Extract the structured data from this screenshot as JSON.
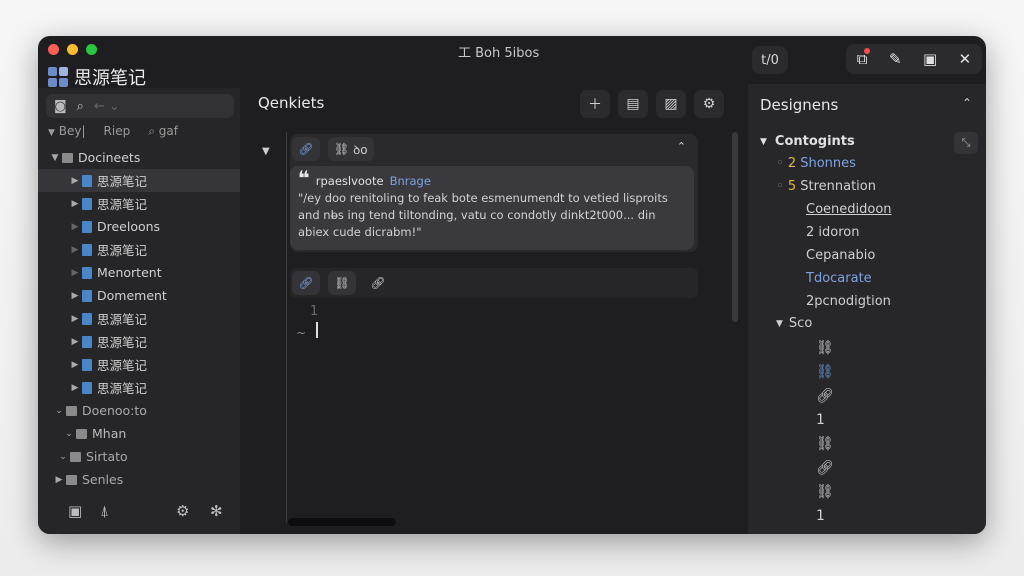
{
  "window": {
    "title": "工 Boh 5ibos"
  },
  "app": {
    "name": "思源笔记"
  },
  "toolbar_right": {
    "badge_label": "t/0"
  },
  "sidebar": {
    "filter": {
      "left": "Bey|",
      "mid": "Riep",
      "right": "gaf"
    },
    "root": "Docineets",
    "items": [
      {
        "label": "思源笔记",
        "selected": true
      },
      {
        "label": "思源笔记"
      },
      {
        "label": "Dreeloons"
      },
      {
        "label": "思源笔记"
      },
      {
        "label": "Menortent"
      },
      {
        "label": "Domement"
      },
      {
        "label": "思源笔记"
      },
      {
        "label": "思源笔记"
      },
      {
        "label": "思源笔记"
      },
      {
        "label": "思源笔记"
      }
    ],
    "folders": [
      {
        "label": "Doenoo:to"
      },
      {
        "label": "Mhan"
      },
      {
        "label": "Sirtato"
      },
      {
        "label": "Senles"
      }
    ]
  },
  "editor": {
    "title": "Qenkiets",
    "card": {
      "chip2": "ꝺo",
      "quote_author": "rpaeslvoote",
      "quote_tag": "Bnrage",
      "quote_text": "\"/ey doo renitoling to feak bote esmenumendt to vetied lisproits and nb̶s ing tend tiltonding, vatu co condotly dinkt2t000... din abiex cude dicrabm!\""
    },
    "line_number": "1",
    "line_marker": "~"
  },
  "right_panel": {
    "title": "Designens",
    "section": "Contogints",
    "outline": [
      {
        "num": "2",
        "label": "Shonnes",
        "style": "blue"
      },
      {
        "num": "5",
        "label": "Strennation",
        "style": "plain"
      },
      {
        "num": "",
        "label": "Coenedidoon",
        "style": "underline"
      },
      {
        "num": "2",
        "label": "idoron",
        "style": "plain"
      },
      {
        "num": "",
        "label": "Cepanabio",
        "style": "plain"
      },
      {
        "num": "",
        "label": "Tdocarate",
        "style": "blue"
      },
      {
        "num": "",
        "label": "2pcnodigtion",
        "style": "plain"
      }
    ],
    "section2": "Sco",
    "mini_values": [
      "1",
      "1"
    ]
  }
}
